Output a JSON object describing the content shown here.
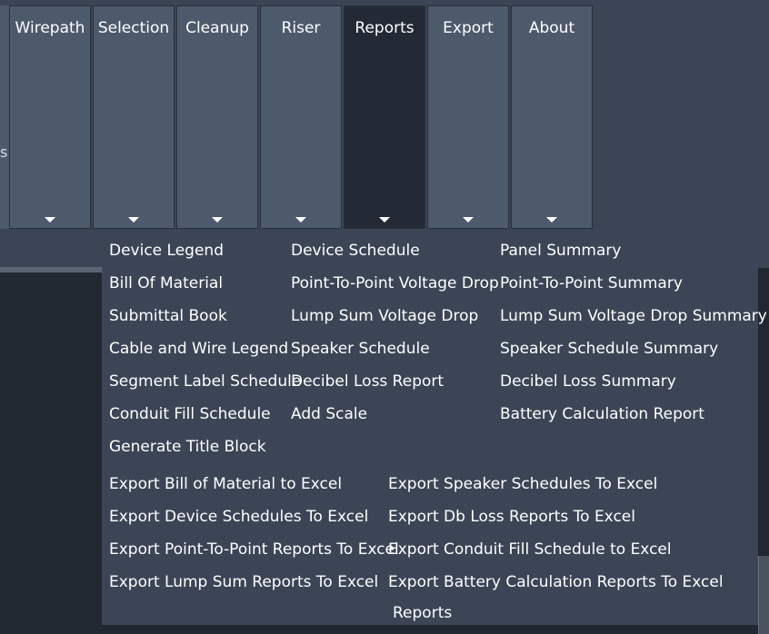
{
  "ribbon": {
    "edge_glyph": "s",
    "tabs": [
      {
        "label": "Wirepath",
        "active": false
      },
      {
        "label": "Selection",
        "active": false
      },
      {
        "label": "Cleanup",
        "active": false
      },
      {
        "label": "Riser",
        "active": false
      },
      {
        "label": "Reports",
        "active": true
      },
      {
        "label": "Export",
        "active": false
      },
      {
        "label": "About",
        "active": false
      }
    ]
  },
  "reports_panel": {
    "caption": "Reports",
    "col1": [
      "Device Legend",
      "Bill Of Material",
      "Submittal Book",
      "Cable and Wire Legend",
      "Segment Label Schedule",
      "Conduit Fill Schedule",
      "Generate Title Block"
    ],
    "col2": [
      "Device Schedule",
      "Point-To-Point Voltage Drop",
      "Lump Sum Voltage Drop",
      "Speaker Schedule",
      "Decibel Loss Report",
      "Add Scale"
    ],
    "col3": [
      "Panel Summary",
      "Point-To-Point Summary",
      "Lump Sum Voltage Drop Summary",
      "Speaker Schedule Summary",
      "Decibel Loss Summary",
      "Battery Calculation Report"
    ],
    "export_col1": [
      "Export Bill of Material to Excel",
      "Export Device Schedules To Excel",
      "Export Point-To-Point Reports To Excel",
      "Export Lump Sum Reports To Excel"
    ],
    "export_col2": [
      "Export Speaker Schedules To Excel",
      "Export Db Loss Reports To Excel",
      "Export Conduit Fill Schedule to Excel",
      "Export Battery Calculation Reports To Excel"
    ]
  }
}
